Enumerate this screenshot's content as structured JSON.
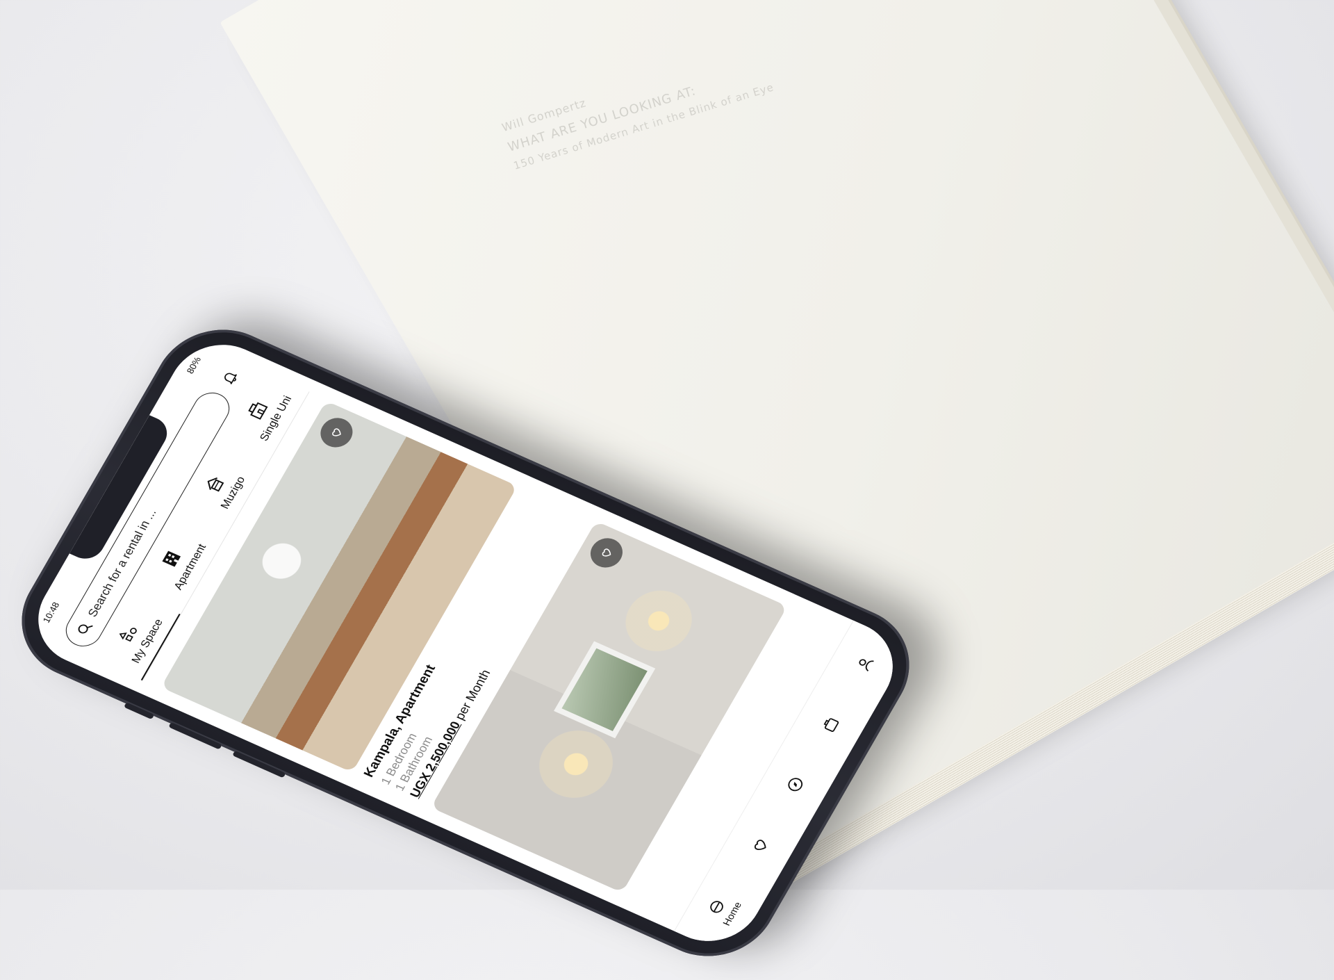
{
  "book": {
    "author": "Will Gompertz",
    "title": "WHAT ARE YOU LOOKING AT:",
    "subtitle": "150 Years of Modern Art in the Blink of an Eye"
  },
  "status_bar": {
    "time": "10:48",
    "battery": "80%"
  },
  "search": {
    "placeholder": "Search for a rental in ...",
    "icon": "search-icon"
  },
  "header": {
    "notification_icon": "bell-icon"
  },
  "categories": [
    {
      "label": "My Space",
      "icon": "my-space-icon",
      "active": true
    },
    {
      "label": "Apartment",
      "icon": "apartment-icon",
      "active": false
    },
    {
      "label": "Muzigo",
      "icon": "house-icon",
      "active": false
    },
    {
      "label": "Single Uni",
      "icon": "building-icon",
      "active": false
    }
  ],
  "listings": [
    {
      "location": "Kampala, Apartment",
      "bedrooms": "1 Bedroom",
      "bathrooms": "1 Bathroom",
      "price": "UGX 2,500,000",
      "price_suffix": "per Month",
      "favorite_icon": "heart-icon"
    },
    {
      "favorite_icon": "heart-icon"
    }
  ],
  "bottom_nav": [
    {
      "label": "Home",
      "icon": "home-icon"
    },
    {
      "icon": "heart-icon"
    },
    {
      "icon": "compass-icon"
    },
    {
      "icon": "bag-icon"
    },
    {
      "icon": "profile-icon"
    }
  ],
  "colors": {
    "phone_frame": "#1f2028",
    "accent": "#111111",
    "book": "#f3f2ec"
  }
}
